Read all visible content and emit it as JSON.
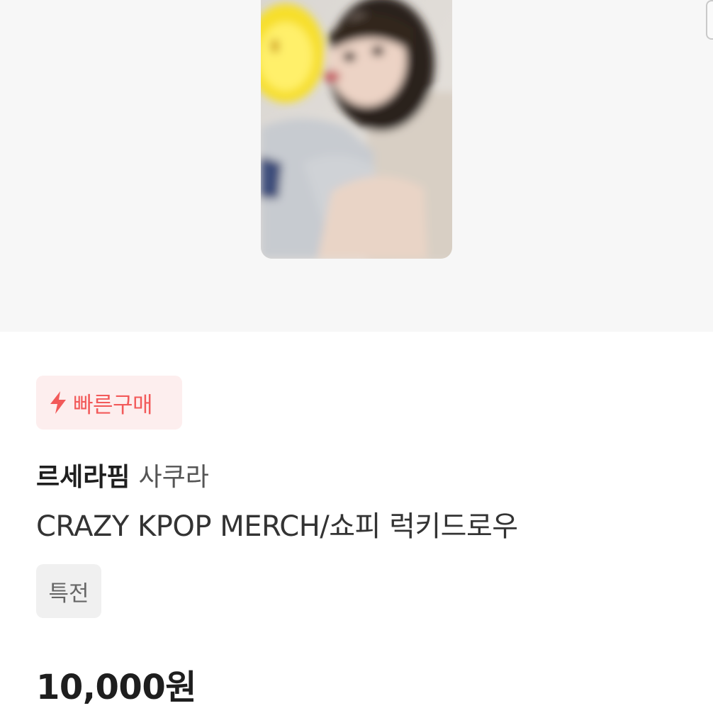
{
  "badge": {
    "label": "빠른구매",
    "icon": "lightning-bolt-icon",
    "color": "#f25a5a",
    "background": "#fdeeee"
  },
  "listing": {
    "brand": "르세라핌",
    "member": "사쿠라",
    "title": "CRAZY KPOP MERCH/쇼피 럭키드로우",
    "tag": "특전",
    "price": "10,000원"
  }
}
